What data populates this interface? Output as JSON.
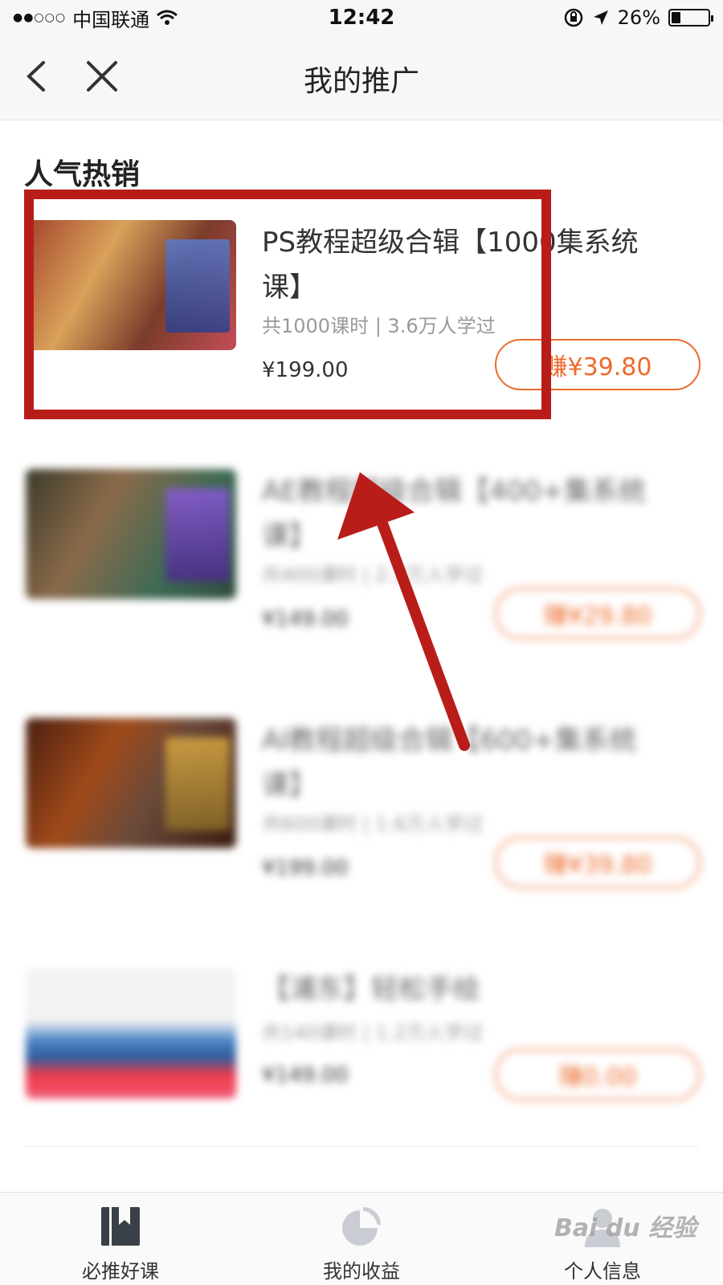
{
  "status_bar": {
    "carrier": "中国联通",
    "time": "12:42",
    "battery": "26%",
    "battery_level": 0.26
  },
  "nav": {
    "title": "我的推广"
  },
  "section": {
    "title": "人气热销"
  },
  "courses": [
    {
      "title": "PS教程超级合辑【1000集系统课】",
      "meta": "共1000课时 | 3.6万人学过",
      "price": "¥199.00",
      "earn": "赚¥39.80"
    },
    {
      "title": "AE教程超级合辑【400+集系统课】",
      "meta": "共400课时 | 2.3万人学过",
      "price": "¥149.00",
      "earn": "赚¥29.80"
    },
    {
      "title": "AI教程超级合辑【600+集系统课】",
      "meta": "共600课时 | 1.6万人学过",
      "price": "¥199.00",
      "earn": "赚¥39.80"
    },
    {
      "title": "【浦东】轻松手绘",
      "meta": "共140课时 | 1.2万人学过",
      "price": "¥149.00",
      "earn": "赚0.00"
    }
  ],
  "tabs": [
    {
      "label": "必推好课",
      "icon": "bookmark-book-icon"
    },
    {
      "label": "我的收益",
      "icon": "pie-chart-icon"
    },
    {
      "label": "个人信息",
      "icon": "user-icon"
    }
  ],
  "colors": {
    "accent": "#ee6a2c",
    "highlight": "#b81d1a"
  }
}
